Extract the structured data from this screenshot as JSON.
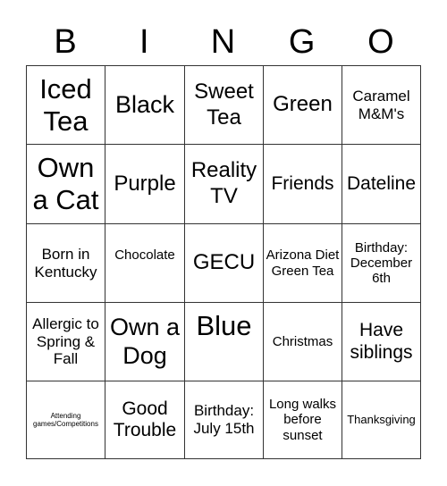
{
  "header": [
    "B",
    "I",
    "N",
    "G",
    "O"
  ],
  "cells": [
    "Iced Tea",
    "Black",
    "Sweet Tea",
    "Green",
    "Caramel M&M's",
    "Own a Cat",
    "Purple",
    "Reality TV",
    "Friends",
    "Dateline",
    "Born in Kentucky",
    "Chocolate",
    "GECU",
    "Arizona Diet Green Tea",
    "Birthday: December 6th",
    "Allergic to Spring & Fall",
    "Own a Dog",
    "Blue",
    "Christmas",
    "Have siblings",
    "Attending games/Competitions",
    "Good Trouble",
    "Birthday: July 15th",
    "Long walks before sunset",
    "Thanksgiving"
  ]
}
